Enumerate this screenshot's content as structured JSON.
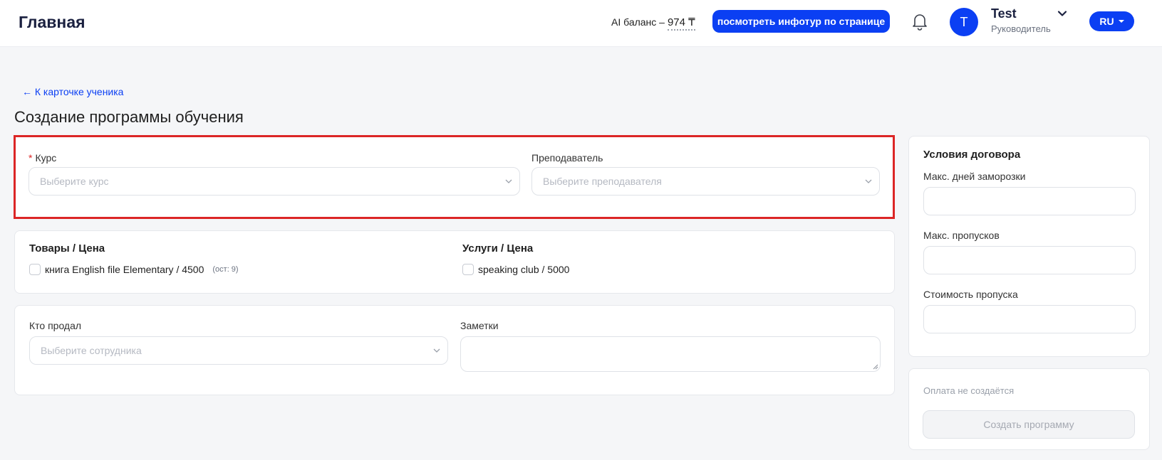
{
  "header": {
    "title": "Главная",
    "ai_balance_label": "AI баланс –",
    "ai_balance_amount": "974 ₸",
    "tour_button": "посмотреть инфотур по странице",
    "user_name": "Test",
    "user_role": "Руководитель",
    "avatar_letter": "T",
    "language": "RU"
  },
  "back_link": "← К карточке ученика",
  "page_title": "Создание программы обучения",
  "course_section": {
    "course_label": "Курс",
    "course_required_mark": "*",
    "course_placeholder": "Выберите курс",
    "teacher_label": "Преподаватель",
    "teacher_placeholder": "Выберите преподавателя"
  },
  "products_section": {
    "goods_title": "Товары / Цена",
    "goods_items": [
      {
        "label": "книга English file Elementary / 4500",
        "stock": "(ост: 9)"
      }
    ],
    "services_title": "Услуги / Цена",
    "services_items": [
      {
        "label": "speaking club / 5000"
      }
    ]
  },
  "seller_section": {
    "seller_label": "Кто продал",
    "seller_placeholder": "Выберите сотрудника",
    "notes_label": "Заметки"
  },
  "contract": {
    "title": "Условия договора",
    "max_freeze_label": "Макс. дней заморозки",
    "max_skips_label": "Макс. пропусков",
    "skip_cost_label": "Стоимость пропуска"
  },
  "payment": {
    "note": "Оплата не создаётся",
    "create_button": "Создать программу"
  },
  "colors": {
    "accent": "#0b3ff3",
    "highlight": "#dc2626"
  }
}
